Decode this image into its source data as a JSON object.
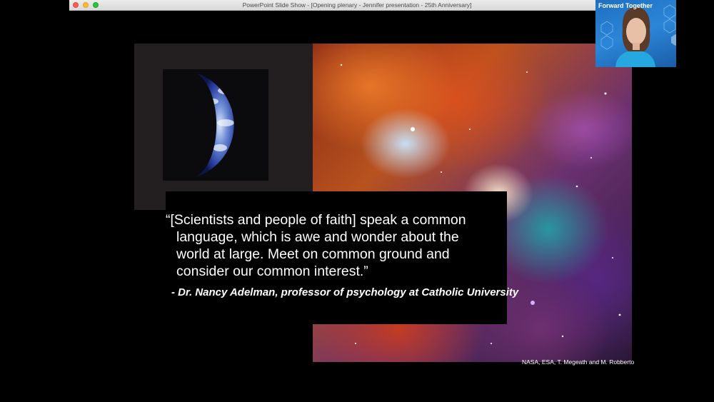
{
  "window": {
    "title": "PowerPoint Slide Show - [Opening plenary - Jennifer presentation - 25th Anniversary]"
  },
  "slide": {
    "quote_lines": [
      "“[Scientists and people of faith] speak a common",
      "language, which is awe and wonder about the",
      "world at large. Meet on common ground and",
      "consider our common interest.”"
    ],
    "attribution": "- Dr. Nancy Adelman, professor of psychology at Catholic University",
    "image_credit": "NASA, ESA, T. Megeath  and M. Robberto"
  },
  "video": {
    "banner_text": "Forward Together"
  },
  "icons": {
    "close": "close-window-icon",
    "minimize": "minimize-window-icon",
    "zoom": "zoom-window-icon"
  },
  "colors": {
    "close": "#fc5f57",
    "minimize": "#fdbc2e",
    "zoom": "#28c840",
    "video_bg": "#2c86d8"
  }
}
